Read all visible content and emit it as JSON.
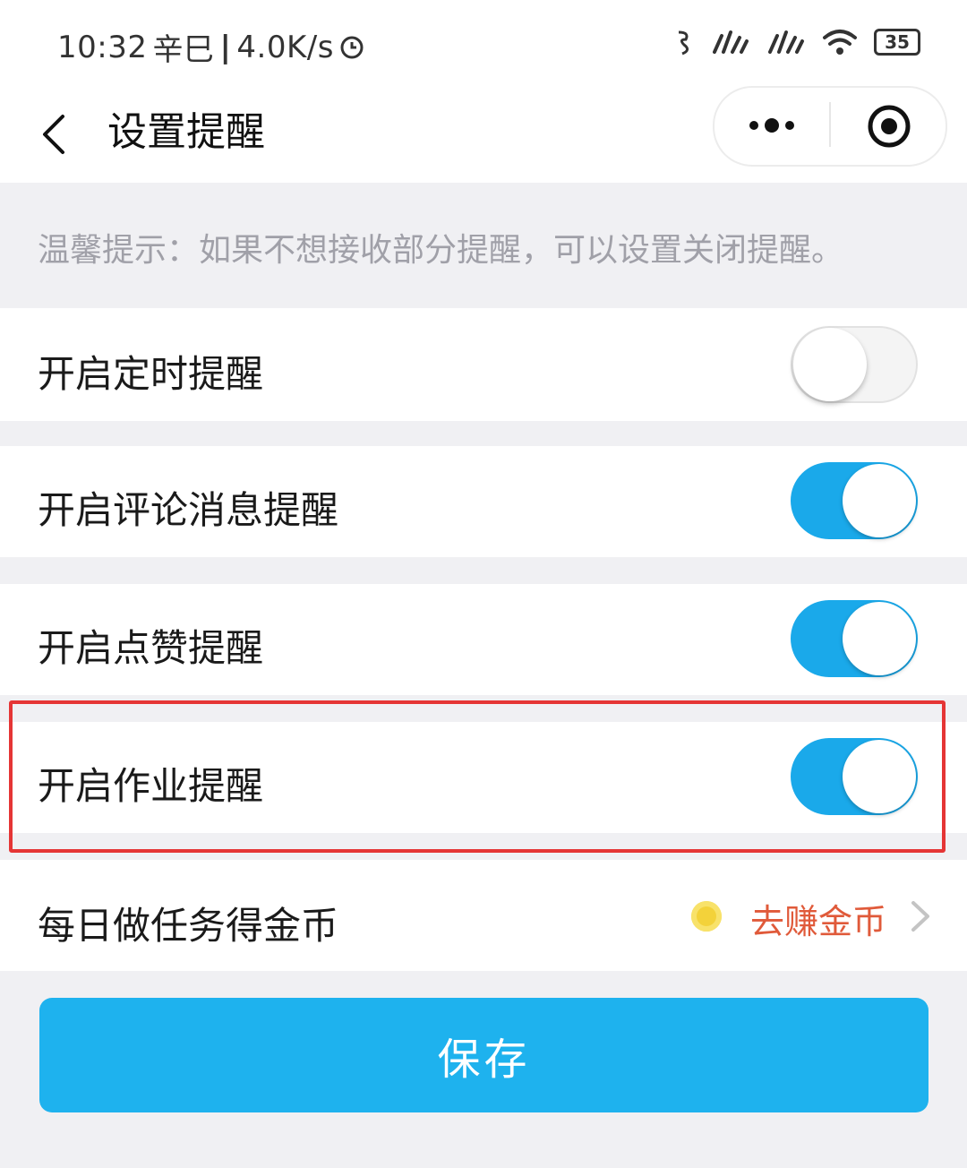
{
  "status_bar": {
    "time": "10:32",
    "extra": "辛巳",
    "speed": "4.0K/s",
    "battery": "35"
  },
  "nav": {
    "title": "设置提醒"
  },
  "tip": "温馨提示：如果不想接收部分提醒，可以设置关闭提醒。",
  "settings": [
    {
      "label": "开启定时提醒",
      "enabled": false
    },
    {
      "label": "开启评论消息提醒",
      "enabled": true
    },
    {
      "label": "开启点赞提醒",
      "enabled": true
    },
    {
      "label": "开启作业提醒",
      "enabled": true
    }
  ],
  "coins_row": {
    "label": "每日做任务得金币",
    "link": "去赚金币"
  },
  "save_label": "保存",
  "colors": {
    "accent": "#1aa9ea",
    "highlight": "#e53535",
    "link": "#e05a3a"
  }
}
